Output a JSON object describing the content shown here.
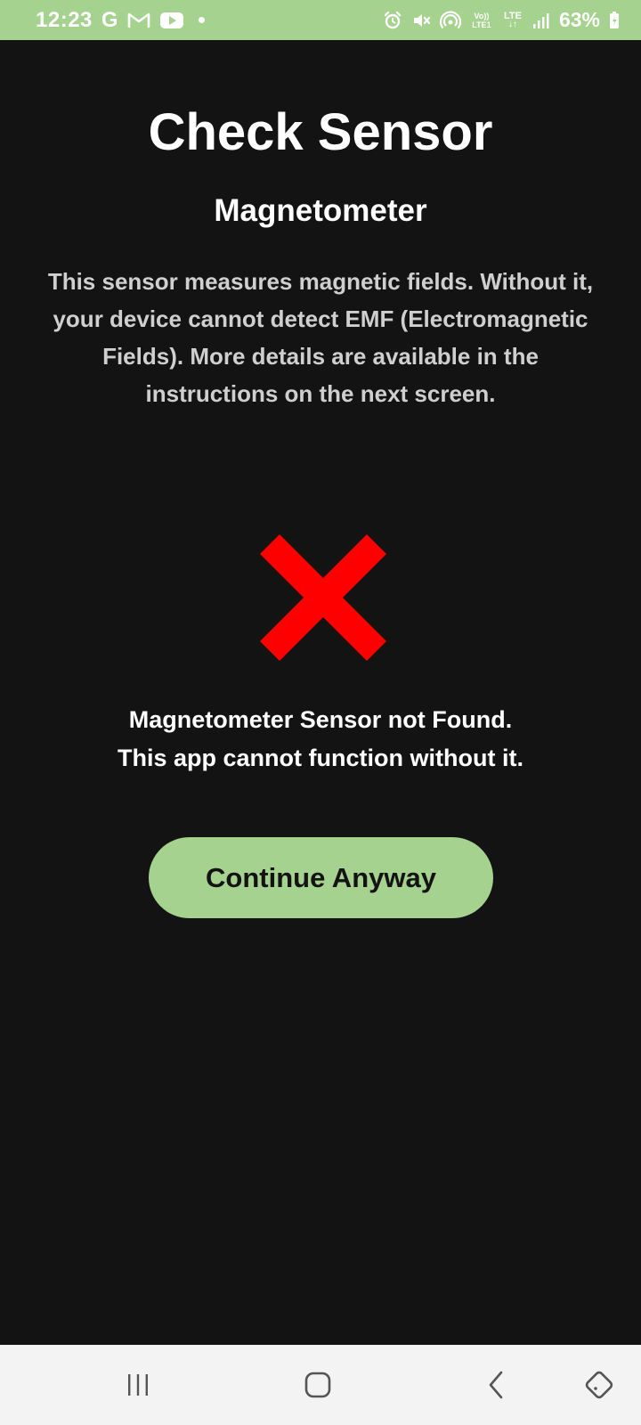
{
  "status_bar": {
    "time": "12:23",
    "google_letter": "G",
    "volte_label": "Vo)) LTE1",
    "lte_label": "LTE",
    "battery_percent": "63%",
    "icons": [
      "gmail-icon",
      "youtube-icon",
      "notification-dot-icon",
      "alarm-icon",
      "mute-icon",
      "hotspot-icon",
      "volte-icon",
      "lte-icon",
      "signal-icon",
      "battery-icon"
    ]
  },
  "page": {
    "title": "Check Sensor",
    "subtitle": "Magnetometer",
    "description": "This sensor measures magnetic fields. Without it, your device cannot detect EMF (Electromagnetic Fields). More details are available in the instructions on the next screen.",
    "status_icon": "error-x-icon",
    "error_line1": "Magnetometer Sensor not Found.",
    "error_line2": "This app cannot function without it.",
    "continue_label": "Continue Anyway"
  },
  "nav_bar": {
    "buttons": [
      "recents-icon",
      "home-icon",
      "back-icon",
      "rotate-icon"
    ]
  },
  "colors": {
    "accent": "#a5d28e",
    "background": "#131313",
    "error": "#ff0000",
    "nav_background": "#f3f3f3"
  }
}
